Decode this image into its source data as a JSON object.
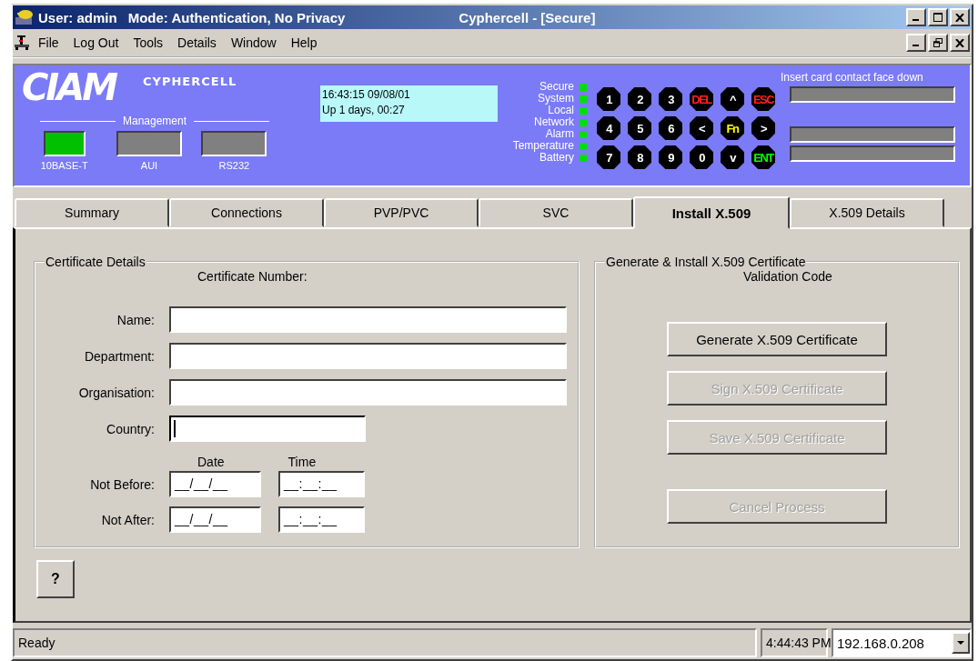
{
  "window": {
    "title_user": "User: admin",
    "title_mode": "Mode: Authentication, No Privacy",
    "title_app": "Cyphercell - [Secure]"
  },
  "menu": [
    "File",
    "Log Out",
    "Tools",
    "Details",
    "Window",
    "Help"
  ],
  "device": {
    "logo": "CIAM",
    "brand": "CYPHERCELL",
    "group_label": "Management",
    "ports": [
      {
        "label": "10BASE-T",
        "on": true
      },
      {
        "label": "AUI",
        "on": false
      },
      {
        "label": "RS232",
        "on": false
      }
    ],
    "lcd": [
      "16:43:15 09/08/01",
      "Up 1 days, 00:27"
    ],
    "leds": [
      {
        "label": "Secure",
        "on": true
      },
      {
        "label": "System",
        "on": true
      },
      {
        "label": "Local",
        "on": true
      },
      {
        "label": "Network",
        "on": true
      },
      {
        "label": "Alarm",
        "on": true
      },
      {
        "label": "Temperature",
        "on": true
      },
      {
        "label": "Battery",
        "on": true
      }
    ],
    "keys": [
      {
        "label": "1",
        "kind": "digit"
      },
      {
        "label": "2",
        "kind": "digit"
      },
      {
        "label": "3",
        "kind": "digit"
      },
      {
        "label": "DEL",
        "kind": "command"
      },
      {
        "label": "^",
        "kind": "arrow"
      },
      {
        "label": "ESC",
        "kind": "command"
      },
      {
        "label": "4",
        "kind": "digit"
      },
      {
        "label": "5",
        "kind": "digit"
      },
      {
        "label": "6",
        "kind": "digit"
      },
      {
        "label": "<",
        "kind": "arrow"
      },
      {
        "label": "Fn",
        "kind": "function"
      },
      {
        "label": ">",
        "kind": "arrow"
      },
      {
        "label": "7",
        "kind": "digit"
      },
      {
        "label": "8",
        "kind": "digit"
      },
      {
        "label": "9",
        "kind": "digit"
      },
      {
        "label": "0",
        "kind": "digit"
      },
      {
        "label": "v",
        "kind": "arrow"
      },
      {
        "label": "ENT",
        "kind": "enter"
      }
    ],
    "card_prompt": "Insert card contact face down"
  },
  "tabs": [
    {
      "label": "Summary",
      "selected": false
    },
    {
      "label": "Connections",
      "selected": false
    },
    {
      "label": "PVP/PVC",
      "selected": false
    },
    {
      "label": "SVC",
      "selected": false
    },
    {
      "label": "Install X.509",
      "selected": true
    },
    {
      "label": "X.509 Details",
      "selected": false
    }
  ],
  "certificate": {
    "legend": "Certificate Details",
    "number_label": "Certificate Number:",
    "fields": [
      {
        "label": "Name:",
        "focused": false
      },
      {
        "label": "Department:",
        "focused": false
      },
      {
        "label": "Organisation:",
        "focused": false
      },
      {
        "label": "Country:",
        "focused": true
      }
    ],
    "date_header": "Date",
    "time_header": "Time",
    "validity": [
      {
        "label": "Not Before:",
        "date": "__/__/__",
        "time": "__:__:__"
      },
      {
        "label": "Not After:",
        "date": "__/__/__",
        "time": "__:__:__"
      }
    ]
  },
  "generate": {
    "legend": "Generate & Install X.509 Certificate",
    "code_label": "Validation Code",
    "buttons": [
      {
        "label": "Generate X.509 Certificate",
        "disabled": false
      },
      {
        "label": "Sign X.509 Certificate",
        "disabled": true
      },
      {
        "label": "Save X.509 Certificate",
        "disabled": true
      },
      {
        "label": "Cancel Process",
        "disabled": true
      }
    ]
  },
  "help_button": "?",
  "status_bar": {
    "message": "Ready",
    "time": "4:44:43 PM",
    "address": "192.168.0.208"
  }
}
